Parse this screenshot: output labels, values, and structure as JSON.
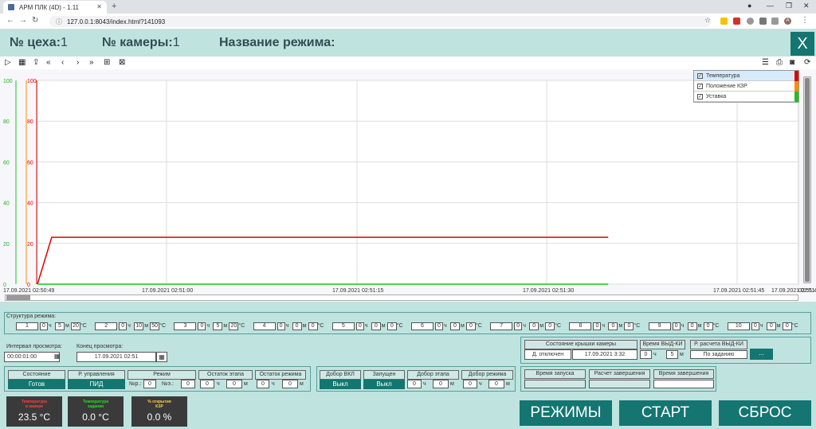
{
  "browser": {
    "tab_title": "АРМ ПЛК (4D) - 1.11",
    "url": "127.0.0.1:8043/index.html?141093",
    "profile": "A"
  },
  "header": {
    "shop_label": "№ цеха:",
    "shop_value": "1",
    "chamber_label": "№ камеры:",
    "chamber_value": "1",
    "mode_name_label": "Название режима:",
    "mode_name_value": "",
    "close": "X"
  },
  "legend": [
    {
      "label": "Температура",
      "color": "#e00000"
    },
    {
      "label": "Положение КЗР",
      "color": "#ff8c00"
    },
    {
      "label": "Уставка",
      "color": "#20c020"
    }
  ],
  "chart_data": {
    "type": "line",
    "y_ticks": [
      "0",
      "20",
      "40",
      "60",
      "80",
      "100"
    ],
    "ylim": [
      0,
      100
    ],
    "x_labels": [
      "17.09.2021 02:50:49",
      "17.09.2021 02:51:00",
      "17.09.2021 02:51:15",
      "17.09.2021 02:51:30",
      "17.09.2021 02:51:45",
      "17.09.2021 02:51:58",
      "02:51:4"
    ],
    "series": [
      {
        "name": "Температура",
        "color": "#e00000",
        "points": [
          [
            0,
            0
          ],
          [
            1.5,
            23
          ],
          [
            60,
            23
          ]
        ]
      },
      {
        "name": "Уставка",
        "color": "#20c020",
        "points": [
          [
            0,
            0
          ],
          [
            60,
            0
          ]
        ]
      }
    ]
  },
  "structure": {
    "label": "Структура режима:",
    "steps": [
      {
        "n": "1",
        "h": "0",
        "m": "5",
        "t": "20"
      },
      {
        "n": "2",
        "h": "0",
        "m": "10",
        "t": "50"
      },
      {
        "n": "3",
        "h": "0",
        "m": "5",
        "t": "20"
      },
      {
        "n": "4",
        "h": "0",
        "m": "0",
        "t": "0"
      },
      {
        "n": "5",
        "h": "0",
        "m": "0",
        "t": "0"
      },
      {
        "n": "6",
        "h": "0",
        "m": "0",
        "t": "0"
      },
      {
        "n": "7",
        "h": "0",
        "m": "0",
        "t": "0"
      },
      {
        "n": "8",
        "h": "0",
        "m": "0",
        "t": "0"
      },
      {
        "n": "9",
        "h": "0",
        "m": "0",
        "t": "0"
      },
      {
        "n": "10",
        "h": "0",
        "m": "0",
        "t": "0"
      }
    ],
    "u_h": "ч",
    "u_m": "м",
    "u_t": "°C"
  },
  "view": {
    "interval_label": "Интервал просмотра:",
    "interval_value": "00:00:01:00",
    "end_label": "Конец просмотра:",
    "end_value": "17.09.2021 02:51"
  },
  "lid": {
    "label": "Состояние крышки камеры",
    "state": "Д. отключен",
    "time": "17.09.2021 3:32",
    "hold_label": "Время ВЫД-КИ",
    "hold_h": "0",
    "hold_m": "5",
    "calc_label": "Р. расчета ВЫД-КИ",
    "calc_value": "По заданию",
    "btn": "..."
  },
  "status": {
    "state_label": "Состояние",
    "state_value": "Готов",
    "control_label": "Р. управления",
    "control_value": "ПИД",
    "mode_label": "Режим",
    "mode_nr": "№р.:",
    "mode_nr_v": "0",
    "mode_ne": "№э.:",
    "mode_ne_v": "0",
    "rest_step_label": "Остаток этапа",
    "rest_step_h": "0",
    "rest_step_m": "0",
    "rest_mode_label": "Остаток режима",
    "rest_mode_h": "0",
    "rest_mode_m": "0",
    "dobor_label": "Добор ВКЛ",
    "dobor_value": "Выкл",
    "run_label": "Запущен",
    "run_value": "Выкл",
    "dobor_step_label": "Добор этапа",
    "dobor_step_h": "0",
    "dobor_step_m": "0",
    "dobor_mode_label": "Добор режима",
    "dobor_mode_h": "0",
    "dobor_mode_m": "0",
    "start_time_label": "Время запуска",
    "calc_end_label": "Расчет завершения",
    "end_time_label": "Время завершения"
  },
  "readouts": [
    {
      "title": "Температура\nв камере",
      "value": "23.5 °C",
      "color": "#ff4040"
    },
    {
      "title": "Температура\nзадания",
      "value": "0.0 °C",
      "color": "#20e020"
    },
    {
      "title": "% открытия\nКЗР",
      "value": "0.0 %",
      "color": "#ffd040"
    }
  ],
  "buttons": {
    "modes": "РЕЖИМЫ",
    "start": "СТАРТ",
    "reset": "СБРОС"
  }
}
